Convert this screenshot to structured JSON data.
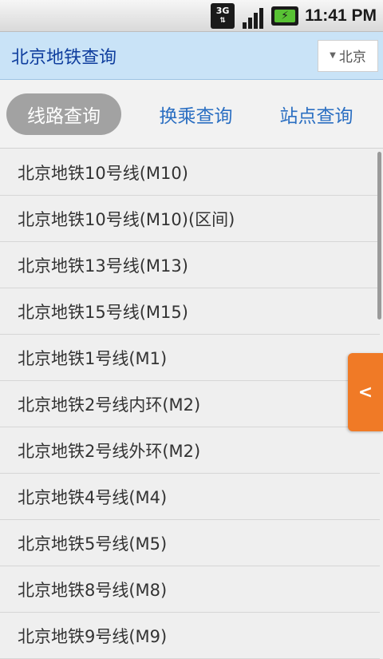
{
  "status_bar": {
    "network_label": "3G",
    "time": "11:41 PM",
    "icons": [
      "3g-icon",
      "signal-icon",
      "battery-charging-icon"
    ]
  },
  "header": {
    "title": "北京地铁查询",
    "city_select": {
      "value": "北京",
      "icon": "caret-down-icon"
    }
  },
  "tabs": [
    {
      "label": "线路查询",
      "active": true
    },
    {
      "label": "换乘查询",
      "active": false
    },
    {
      "label": "站点查询",
      "active": false
    }
  ],
  "routes": [
    "北京地铁10号线(M10)",
    "北京地铁10号线(M10)(区间)",
    "北京地铁13号线(M13)",
    "北京地铁15号线(M15)",
    "北京地铁1号线(M1)",
    "北京地铁2号线内环(M2)",
    "北京地铁2号线外环(M2)",
    "北京地铁4号线(M4)",
    "北京地铁5号线(M5)",
    "北京地铁8号线(M8)",
    "北京地铁9号线(M9)"
  ],
  "side_toggle": {
    "label": "<"
  },
  "colors": {
    "accent": "#2b6fc2",
    "header_bg": "#c9e3f7",
    "toggle": "#f07a26"
  }
}
